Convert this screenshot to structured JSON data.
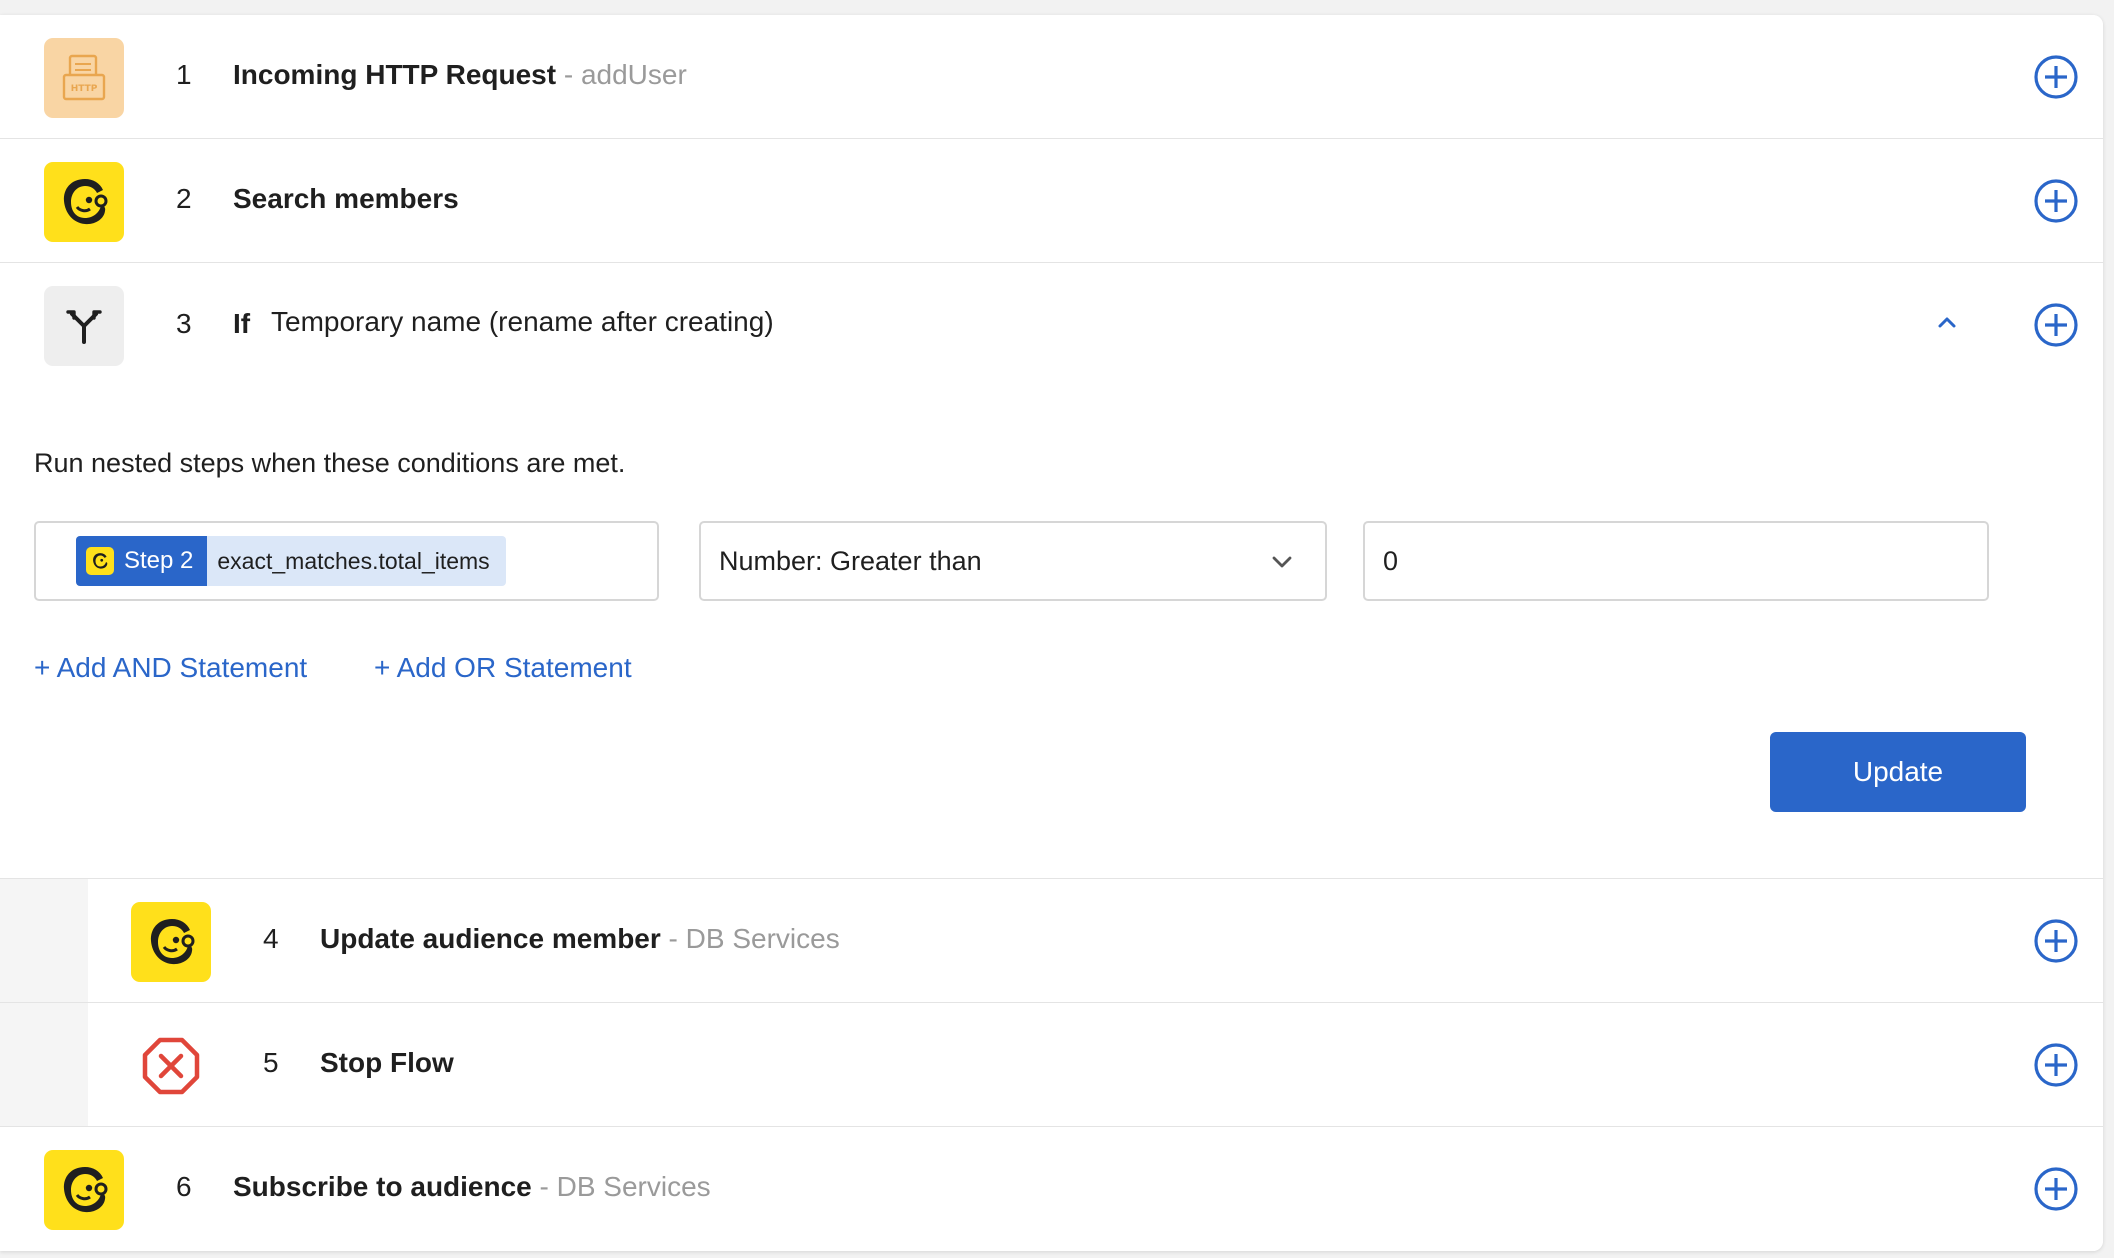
{
  "steps": [
    {
      "num": "1",
      "title": "Incoming HTTP Request",
      "sub": " - addUser",
      "icon": "http-icon"
    },
    {
      "num": "2",
      "title": "Search members",
      "sub": "",
      "icon": "mailchimp-icon"
    },
    {
      "num": "3",
      "keyword": "If",
      "title": "Temporary name (rename after creating)",
      "icon": "branch-icon"
    },
    {
      "num": "4",
      "title": "Update audience member",
      "sub": " - DB Services",
      "icon": "mailchimp-icon"
    },
    {
      "num": "5",
      "title": "Stop Flow",
      "sub": "",
      "icon": "stop-icon"
    },
    {
      "num": "6",
      "title": "Subscribe to audience",
      "sub": " - DB Services",
      "icon": "mailchimp-icon"
    }
  ],
  "http_icon_text": "HTTP",
  "condition": {
    "description": "Run nested steps when these conditions are met.",
    "token_step": "Step 2",
    "token_path": "exact_matches.total_items",
    "operator": "Number: Greater than",
    "value": "0",
    "add_and": "+ Add AND Statement",
    "add_or": "+ Add OR Statement",
    "update_label": "Update"
  },
  "colors": {
    "accent": "#2a66c9",
    "mailchimp_yellow": "#ffe01b",
    "http_orange": "#f9d5a4",
    "stop_red": "#e0463a",
    "muted_text": "#9a9a9a"
  }
}
